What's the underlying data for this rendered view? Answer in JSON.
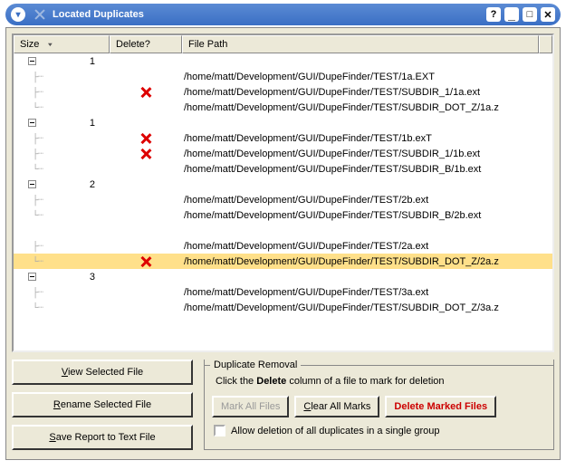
{
  "window": {
    "title": "Located Duplicates"
  },
  "columns": {
    "size": "Size",
    "delete": "Delete?",
    "path": "File Path"
  },
  "rows": [
    {
      "type": "group",
      "size": "1"
    },
    {
      "type": "file",
      "del": false,
      "path": "/home/matt/Development/GUI/DupeFinder/TEST/1a.EXT"
    },
    {
      "type": "file",
      "del": true,
      "path": "/home/matt/Development/GUI/DupeFinder/TEST/SUBDIR_1/1a.ext"
    },
    {
      "type": "file",
      "del": false,
      "path": "/home/matt/Development/GUI/DupeFinder/TEST/SUBDIR_DOT_Z/1a.z",
      "last": true
    },
    {
      "type": "group",
      "size": "1"
    },
    {
      "type": "file",
      "del": true,
      "path": "/home/matt/Development/GUI/DupeFinder/TEST/1b.exT"
    },
    {
      "type": "file",
      "del": true,
      "path": "/home/matt/Development/GUI/DupeFinder/TEST/SUBDIR_1/1b.ext"
    },
    {
      "type": "file",
      "del": false,
      "path": "/home/matt/Development/GUI/DupeFinder/TEST/SUBDIR_B/1b.ext",
      "last": true
    },
    {
      "type": "group",
      "size": "2"
    },
    {
      "type": "file",
      "del": false,
      "path": "/home/matt/Development/GUI/DupeFinder/TEST/2b.ext"
    },
    {
      "type": "file",
      "del": false,
      "path": "/home/matt/Development/GUI/DupeFinder/TEST/SUBDIR_B/2b.ext",
      "last": true
    },
    {
      "type": "blank"
    },
    {
      "type": "file",
      "del": false,
      "path": "/home/matt/Development/GUI/DupeFinder/TEST/2a.ext"
    },
    {
      "type": "file",
      "del": true,
      "path": "/home/matt/Development/GUI/DupeFinder/TEST/SUBDIR_DOT_Z/2a.z",
      "last": true,
      "selected": true
    },
    {
      "type": "group",
      "size": "3"
    },
    {
      "type": "file",
      "del": false,
      "path": "/home/matt/Development/GUI/DupeFinder/TEST/3a.ext"
    },
    {
      "type": "file",
      "del": false,
      "path": "/home/matt/Development/GUI/DupeFinder/TEST/SUBDIR_DOT_Z/3a.z",
      "last": true
    }
  ],
  "buttons": {
    "view": "iew Selected File",
    "view_u": "V",
    "rename": "ename Selected File",
    "rename_u": "R",
    "save": "ave Report to Text File",
    "save_u": "S"
  },
  "removal": {
    "legend": "Duplicate Removal",
    "instr_pre": "Click the ",
    "instr_bold": "Delete",
    "instr_post": " column of a file to mark for deletion",
    "mark_all": "Mark All Files",
    "clear_all_u": "C",
    "clear_all": "lear All Marks",
    "delete_marked": "Delete Marked Files",
    "allow_u": "A",
    "allow": "llow deletion of all duplicates in a single group"
  }
}
